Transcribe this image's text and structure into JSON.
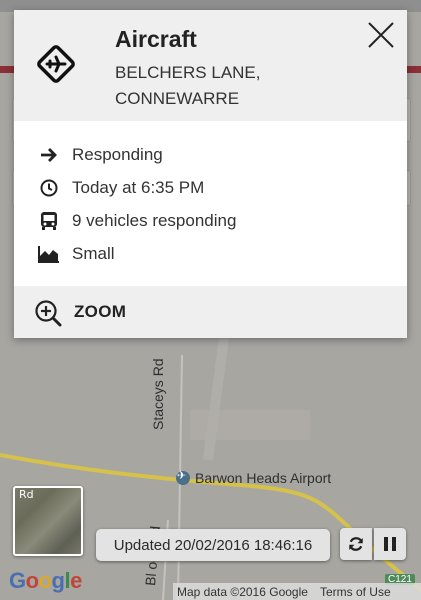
{
  "incident": {
    "title": "Aircraft",
    "location": "BELCHERS LANE, CONNEWARRE",
    "status": "Responding",
    "time": "Today at 6:35 PM",
    "vehicles": "9 vehicles responding",
    "size": "Small",
    "zoom_label": "ZOOM",
    "icon": "aircraft-diamond-icon"
  },
  "map": {
    "road_labels": [
      "Staceys Rd",
      "Bl  ock Rd"
    ],
    "airport_label": "Barwon Heads Airport",
    "thumb_label": "Rd",
    "updated": "Updated 20/02/2016 18:46:16",
    "attribution": "Map data ©2016 Google",
    "terms": "Terms of Use",
    "route_shield": "C121",
    "google_logo": "Google"
  },
  "colors": {
    "header_bg": "#efefef",
    "overlay_map": "#a7a6a1",
    "brand_red": "#8a3036",
    "road_yellow": "#d6c24a"
  }
}
